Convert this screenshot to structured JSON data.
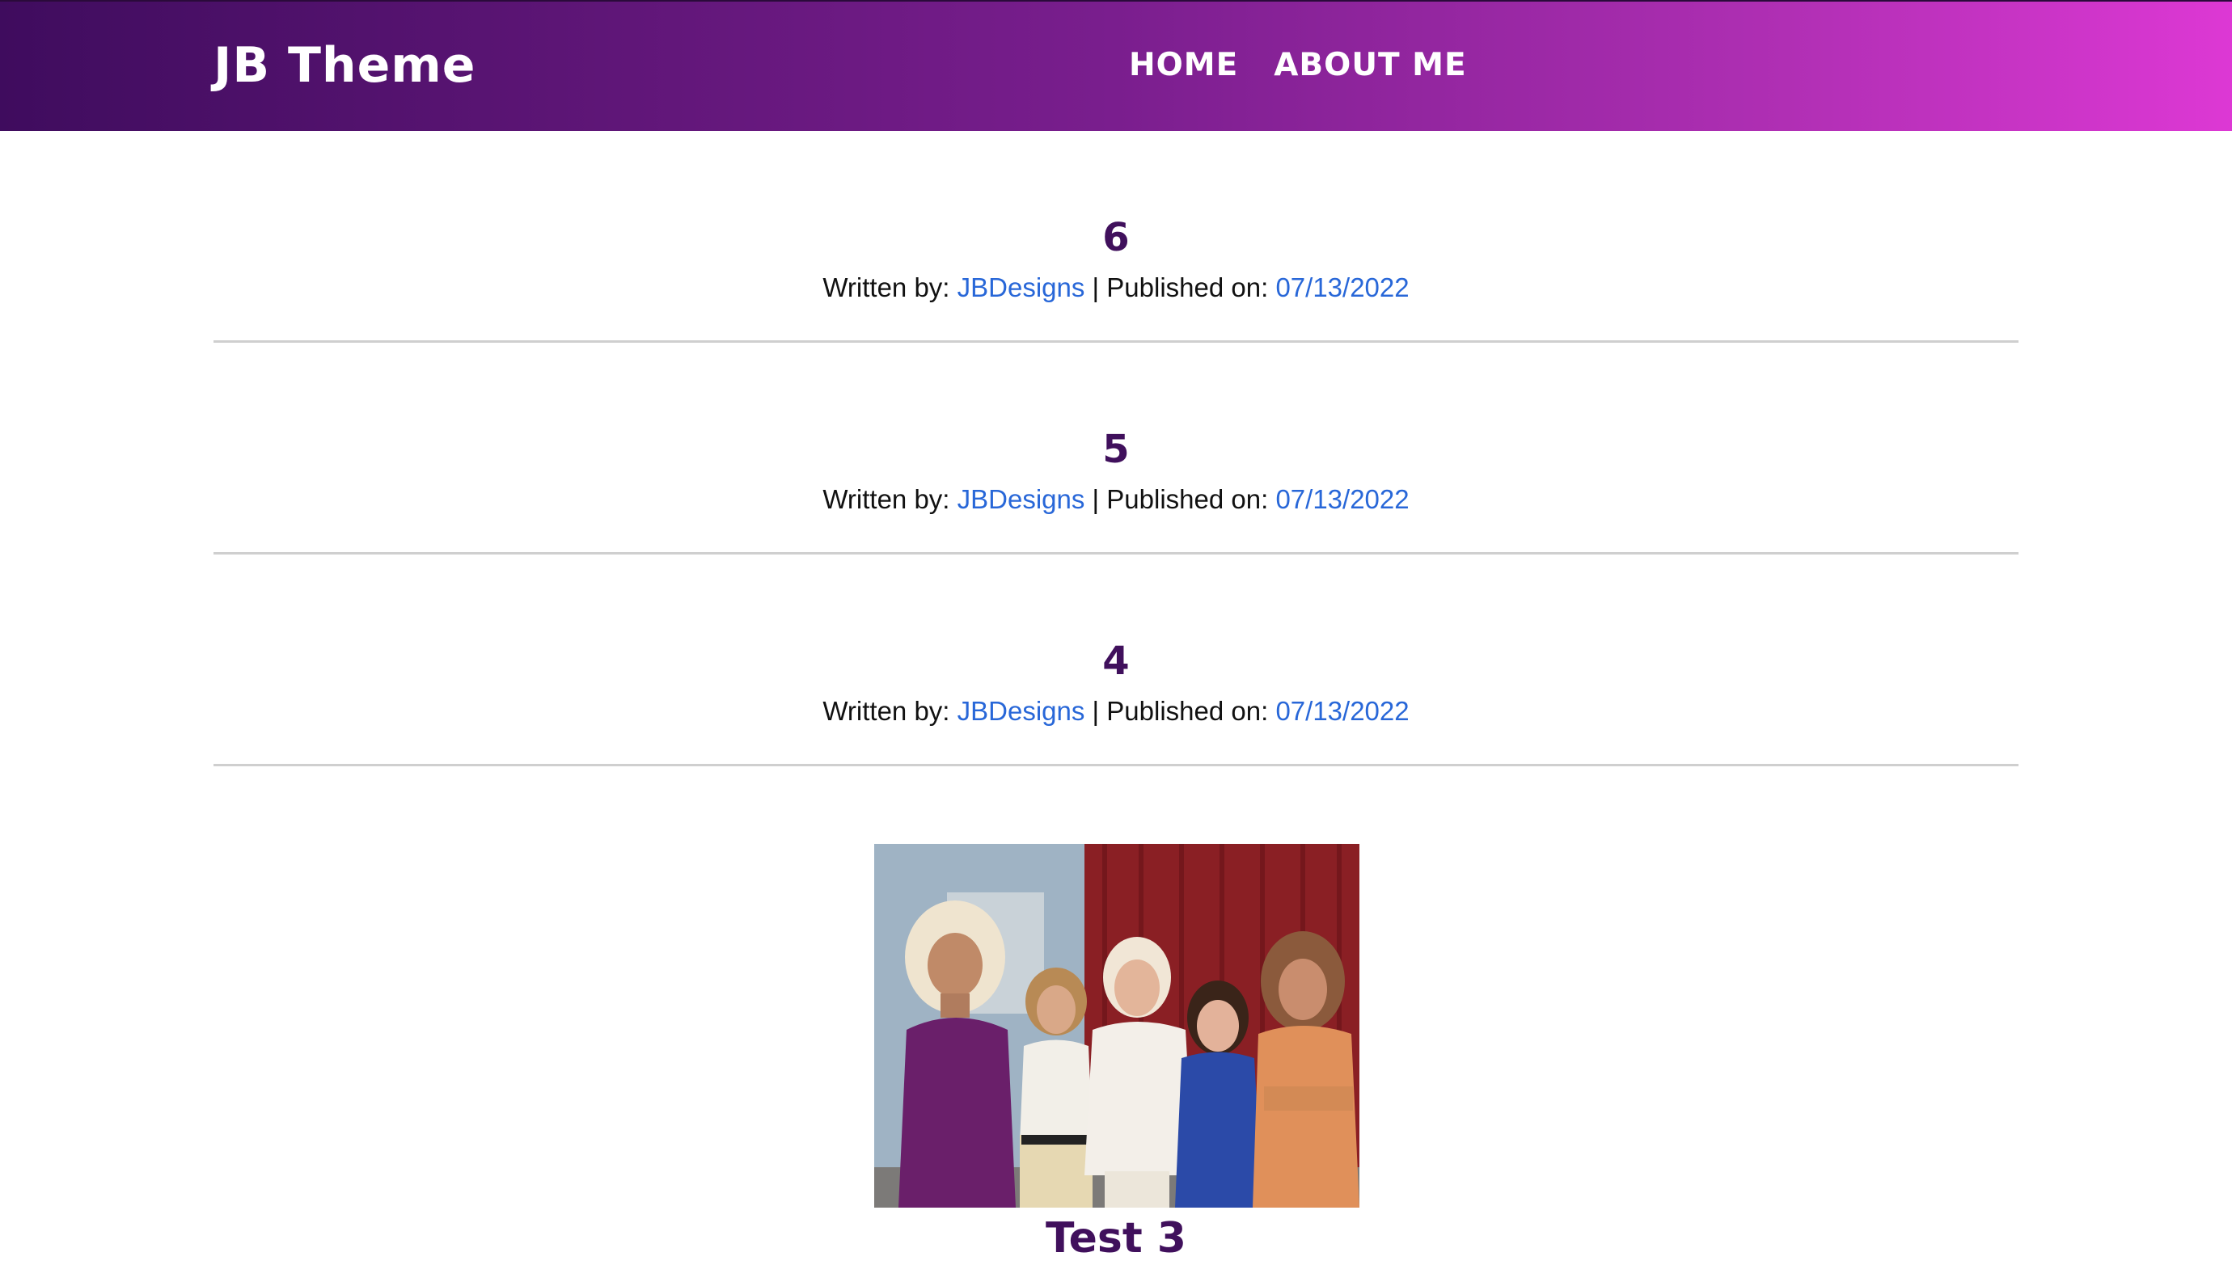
{
  "header": {
    "site_title": "JB Theme",
    "nav": [
      {
        "label": "HOME"
      },
      {
        "label": "ABOUT ME"
      }
    ]
  },
  "posts": [
    {
      "title": "6",
      "written_by_label": "Written by:",
      "author": "JBDesigns",
      "separator": "|",
      "published_label": "Published on:",
      "date": "07/13/2022"
    },
    {
      "title": "5",
      "written_by_label": "Written by:",
      "author": "JBDesigns",
      "separator": "|",
      "published_label": "Published on:",
      "date": "07/13/2022"
    },
    {
      "title": "4",
      "written_by_label": "Written by:",
      "author": "JBDesigns",
      "separator": "|",
      "published_label": "Published on:",
      "date": "07/13/2022"
    }
  ],
  "featured_post": {
    "title": "Test 3"
  },
  "colors": {
    "header_gradient_start": "#3f0c5e",
    "header_gradient_end": "#dd38d4",
    "post_title": "#40105c",
    "link": "#2867d8"
  }
}
